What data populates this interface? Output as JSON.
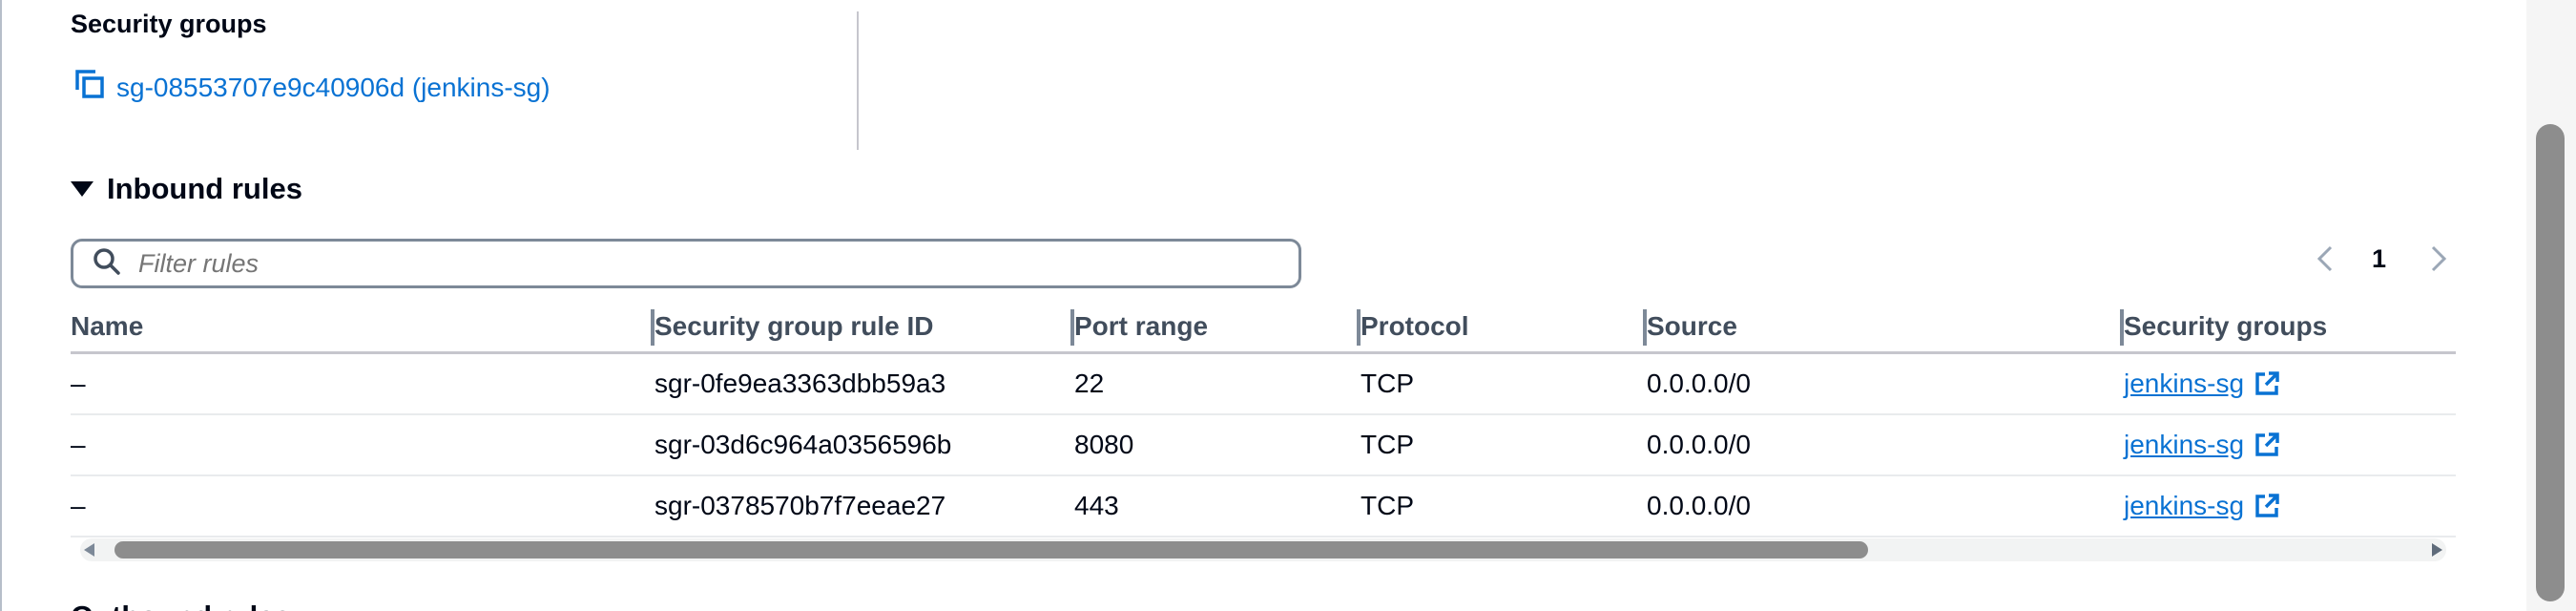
{
  "security_groups_section": {
    "title": "Security groups",
    "group_link": "sg-08553707e9c40906d (jenkins-sg)"
  },
  "inbound_rules": {
    "title": "Inbound rules",
    "filter_placeholder": "Filter rules",
    "pagination": {
      "current_page": "1"
    },
    "columns": [
      "Name",
      "Security group rule ID",
      "Port range",
      "Protocol",
      "Source",
      "Security groups"
    ],
    "rows": [
      {
        "name": "–",
        "rule_id": "sgr-0fe9ea3363dbb59a3",
        "port_range": "22",
        "protocol": "TCP",
        "source": "0.0.0.0/0",
        "security_group": "jenkins-sg"
      },
      {
        "name": "–",
        "rule_id": "sgr-03d6c964a0356596b",
        "port_range": "8080",
        "protocol": "TCP",
        "source": "0.0.0.0/0",
        "security_group": "jenkins-sg"
      },
      {
        "name": "–",
        "rule_id": "sgr-0378570b7f7eeae27",
        "port_range": "443",
        "protocol": "TCP",
        "source": "0.0.0.0/0",
        "security_group": "jenkins-sg"
      }
    ]
  },
  "outbound_rules": {
    "title": "Outbound rules"
  },
  "icons": {
    "copy": "copy-icon",
    "caret": "caret-down-icon",
    "search": "search-icon",
    "prev": "chevron-left-icon",
    "next": "chevron-right-icon",
    "external": "external-link-icon"
  },
  "colors": {
    "link": "#0972d3",
    "text": "#000716",
    "header_text": "#414d5c",
    "border": "#7d8998"
  }
}
